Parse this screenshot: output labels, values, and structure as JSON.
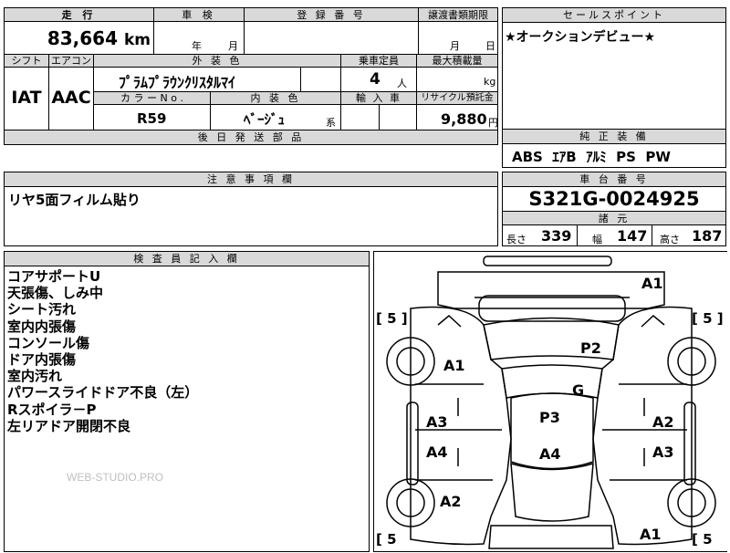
{
  "header": {
    "mileage_label": "走 行",
    "inspection_label": "車 検",
    "registration_label": "登 録 番 号",
    "transfer_deadline_label": "譲渡書類期限",
    "sales_point_label": "セールスポイント",
    "mileage_value": "83,664",
    "mileage_unit": "km",
    "year_label": "年",
    "month_label": "月",
    "transfer_month_label": "月",
    "transfer_day_label": "日"
  },
  "specs": {
    "shift_label": "シフト",
    "aircon_label": "エアコン",
    "exterior_color_label": "外 装 色",
    "capacity_label": "乗車定員",
    "max_load_label": "最大積載量",
    "shift_value": "IAT",
    "aircon_value": "AAC",
    "exterior_color_value": "ﾌﾟﾗﾑﾌﾟﾗｳﾝｸﾘｽﾀﾙﾏｲ",
    "capacity_value": "4",
    "capacity_unit": "人",
    "load_unit": "kg",
    "color_no_label": "カ ラ ー N o .",
    "interior_color_label": "内 装 色",
    "import_label": "輸 入 車",
    "recycle_label": "リサイクル預託金",
    "color_no_value": "R59",
    "interior_color_value": "ﾍﾞｰｼﾞｭ",
    "interior_color_suffix": "系",
    "recycle_value": "9,880",
    "recycle_unit": "円",
    "followup_parts_label": "後 日 発 送 部 品"
  },
  "sales_point": {
    "text": "★オークションデビュー★"
  },
  "equipment": {
    "label": "純 正 装 備",
    "value": "ABS  ｴｱB  ｱﾙﾐ  PS  PW"
  },
  "caution": {
    "label": "注 意 事 項 欄",
    "text": "リヤ5面フィルム貼り"
  },
  "chassis": {
    "label": "車 台 番 号",
    "value": "S321G-0024925",
    "dims_label": "諸 元",
    "length_label": "長さ",
    "length_value": "339",
    "width_label": "幅",
    "width_value": "147",
    "height_label": "高さ",
    "height_value": "187"
  },
  "inspector": {
    "label": "検 査 員 記 入 欄",
    "notes": [
      "コアサポートU",
      "天張傷、しみ中",
      "シート汚れ",
      "室内内張傷",
      "コンソール傷",
      "ドア内張傷",
      "室内汚れ",
      "パワースライドドア不良（左）",
      "Rスポイラ－P",
      "左リアドア開閉不良"
    ]
  },
  "watermark": "WEB-STUDIO.PRO",
  "diagram": {
    "marks": {
      "a1_top_right": "A1",
      "p2": "P2",
      "a1_left": "A1",
      "g": "G",
      "p3": "P3",
      "a3_left": "A3",
      "a2_right": "A2",
      "a4_left": "A4",
      "a4_center": "A4",
      "a3_right": "A3",
      "a2_left": "A2",
      "a1_bottom_right": "A1"
    },
    "tires": {
      "tl": "[ 5 ]",
      "tr": "[ 5 ]",
      "bl": "[ 5",
      "br": "[ 5"
    }
  }
}
